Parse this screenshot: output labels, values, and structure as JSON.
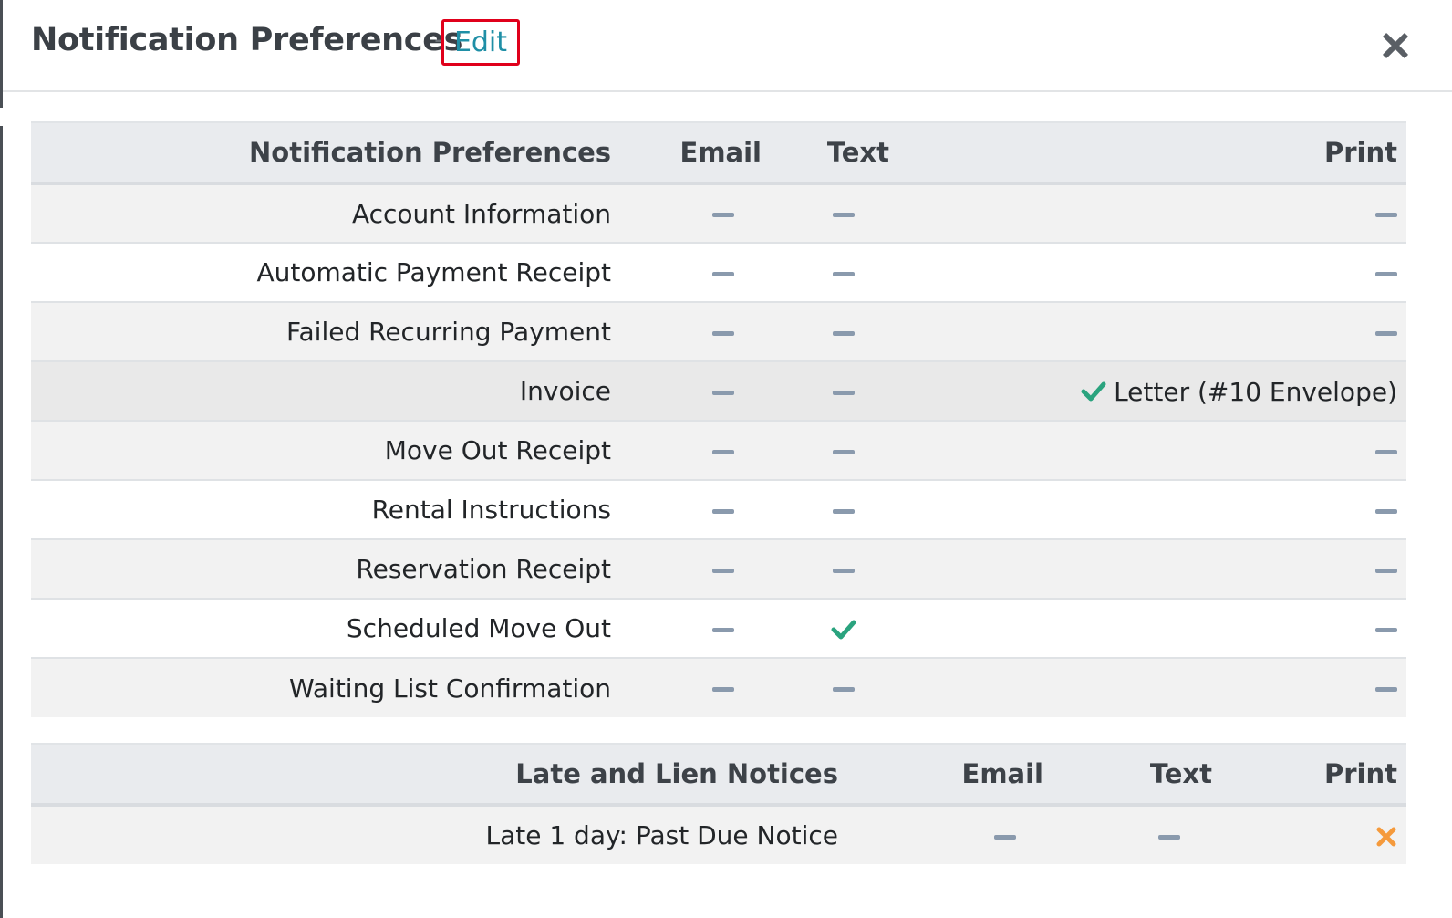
{
  "header": {
    "title": "Notification Preferences",
    "separator": "-",
    "edit_label": "Edit"
  },
  "colors": {
    "check": "#2aa37e",
    "dash": "#8a9aad",
    "x": "#f59a3c",
    "edit_link": "#1f8fa6",
    "highlight_border": "#e0001b"
  },
  "main_table": {
    "columns": [
      "Notification Preferences",
      "Email",
      "Text",
      "Print"
    ],
    "rows": [
      {
        "name": "Account Information",
        "email": "dash",
        "text": "dash",
        "print": "dash"
      },
      {
        "name": "Automatic Payment Receipt",
        "email": "dash",
        "text": "dash",
        "print": "dash"
      },
      {
        "name": "Failed Recurring Payment",
        "email": "dash",
        "text": "dash",
        "print": "dash"
      },
      {
        "name": "Invoice",
        "email": "dash",
        "text": "dash",
        "print": "check",
        "print_label": "Letter (#10 Envelope)"
      },
      {
        "name": "Move Out Receipt",
        "email": "dash",
        "text": "dash",
        "print": "dash"
      },
      {
        "name": "Rental Instructions",
        "email": "dash",
        "text": "dash",
        "print": "dash"
      },
      {
        "name": "Reservation Receipt",
        "email": "dash",
        "text": "dash",
        "print": "dash"
      },
      {
        "name": "Scheduled Move Out",
        "email": "dash",
        "text": "check",
        "print": "dash"
      },
      {
        "name": "Waiting List Confirmation",
        "email": "dash",
        "text": "dash",
        "print": "dash"
      }
    ]
  },
  "late_table": {
    "columns": [
      "Late and Lien Notices",
      "Email",
      "Text",
      "Print"
    ],
    "rows": [
      {
        "name": "Late 1 day: Past Due Notice",
        "email": "dash",
        "text": "dash",
        "print": "x"
      }
    ]
  }
}
